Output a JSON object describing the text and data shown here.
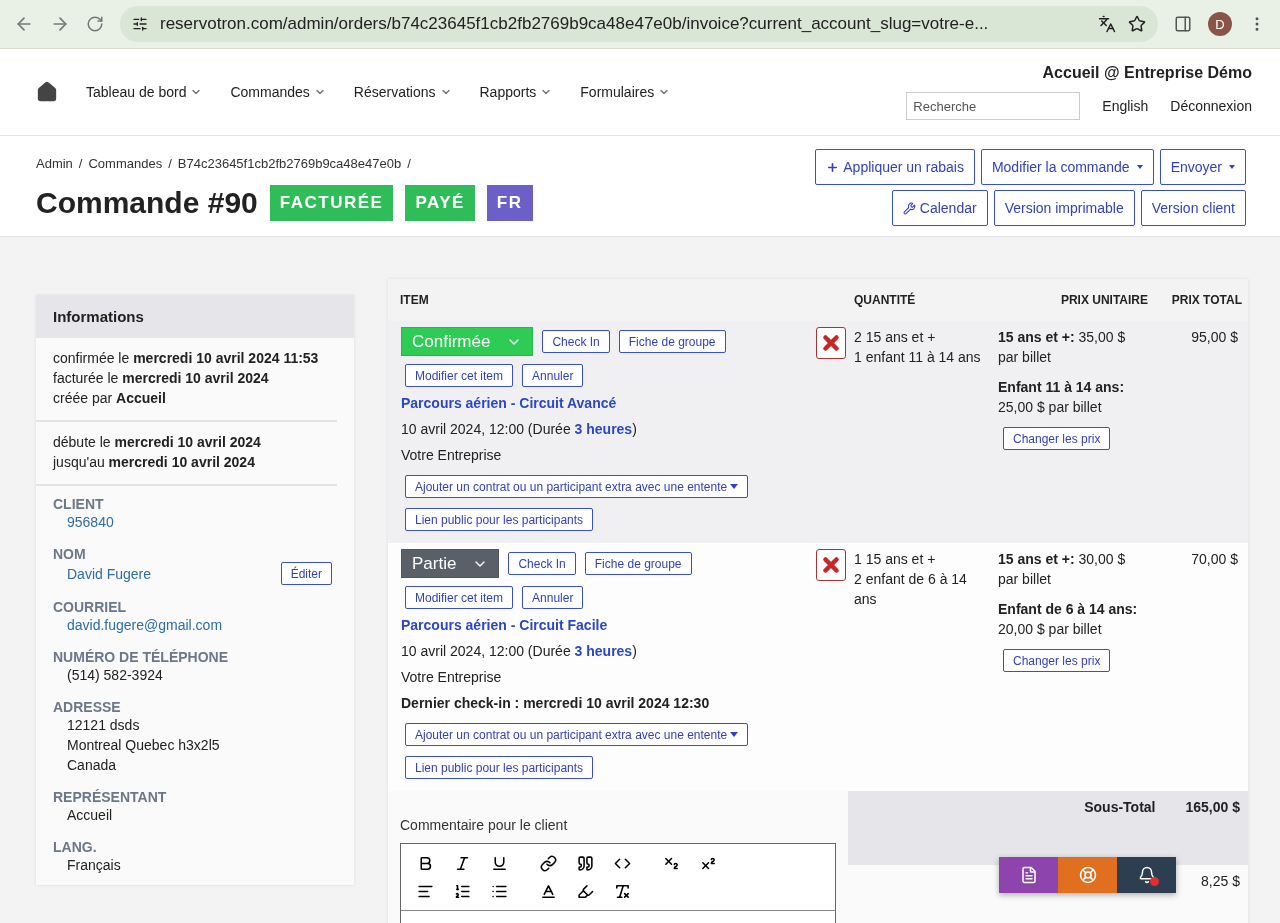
{
  "browser": {
    "url": "reservotron.com/admin/orders/b74c23645f1cb2fb2769b9ca48e47e0b/invoice?current_account_slug=votre-e...",
    "avatar": "D"
  },
  "nav": {
    "items": [
      {
        "label": "Tableau de bord"
      },
      {
        "label": "Commandes"
      },
      {
        "label": "Réservations"
      },
      {
        "label": "Rapports"
      },
      {
        "label": "Formulaires"
      }
    ],
    "account": "Accueil @ Entreprise Démo",
    "search_placeholder": "Recherche",
    "language": "English",
    "logout": "Déconnexion"
  },
  "header": {
    "breadcrumb": [
      {
        "label": "Admin",
        "separator": "/"
      },
      {
        "label": "Commandes",
        "separator": "/"
      },
      {
        "label": "B74c23645f1cb2fb2769b9ca48e47e0b",
        "separator": "/"
      }
    ],
    "title": "Commande #90",
    "badges": [
      {
        "label": "FACTURÉE",
        "color": "#2ebd59"
      },
      {
        "label": "PAYÉ",
        "color": "#2ebd59"
      },
      {
        "label": "FR",
        "color": "#6c5fc7"
      }
    ],
    "actions": [
      [
        {
          "label": "Appliquer un rabais",
          "kind": "plus"
        },
        {
          "label": "Modifier la commande",
          "kind": "caret"
        },
        {
          "label": "Envoyer",
          "kind": "caret"
        }
      ],
      [
        {
          "label": "Calendar",
          "kind": "wrench"
        },
        {
          "label": "Version imprimable",
          "kind": "plain"
        },
        {
          "label": "Version client",
          "kind": "plain"
        }
      ]
    ]
  },
  "info": {
    "title": "Informations",
    "groups": [
      [
        "confirmée le **mercredi 10 avril 2024 11:53**",
        "facturée le **mercredi 10 avril 2024**",
        "créée par **Accueil**"
      ],
      [
        "débute le **mercredi 10 avril 2024**",
        "jusqu'au **mercredi 10 avril 2024**"
      ]
    ],
    "fields": [
      {
        "label": "CLIENT",
        "kind": "link",
        "values": [
          "956840"
        ]
      },
      {
        "label": "NOM",
        "kind": "link",
        "values": [
          "David Fugere"
        ],
        "button": "Éditer"
      },
      {
        "label": "COURRIEL",
        "kind": "link",
        "values": [
          "david.fugere@gmail.com"
        ]
      },
      {
        "label": "NUMÉRO DE TÉLÉPHONE",
        "kind": "text",
        "values": [
          "(514) 582-3924"
        ]
      },
      {
        "label": "ADRESSE",
        "kind": "text",
        "values": [
          "12121 dsds",
          "Montreal Quebec h3x2l5",
          "Canada"
        ]
      },
      {
        "label": "REPRÉSENTANT",
        "kind": "text",
        "values": [
          "Accueil"
        ]
      },
      {
        "label": "LANG.",
        "kind": "text",
        "values": [
          "Français"
        ]
      }
    ]
  },
  "items": {
    "columns": [
      "ITEM",
      "QUANTITÉ",
      "PRIX UNITAIRE",
      "PRIX TOTAL"
    ],
    "rows": [
      {
        "status": {
          "label": "Confirmée",
          "color": "#2ecc55"
        },
        "check_in": "Check In",
        "group_sheet": "Fiche de groupe",
        "edit": "Modifier cet item",
        "cancel": "Annuler",
        "product": "Parcours aérien - Circuit Avancé",
        "schedule_prefix": "10 avril 2024, 12:00 (Durée",
        "duration": "3 heures",
        "schedule_suffix": ")",
        "location": "Votre Entreprise",
        "contract": "Ajouter un contrat ou un participant extra avec une entente",
        "public_link": "Lien public pour les participants",
        "quantity": [
          "2 15 ans et +",
          "1 enfant 11 à 14 ans"
        ],
        "prices": [
          "**15 ans et +:** 35,00 $ par billet",
          "**Enfant 11 à 14 ans:** 25,00 $ par billet"
        ],
        "change_price": "Changer les prix",
        "total": "95,00 $",
        "shaded": true
      },
      {
        "status": {
          "label": "Partie",
          "color": "#5a6068"
        },
        "check_in": "Check In",
        "group_sheet": "Fiche de groupe",
        "edit": "Modifier cet item",
        "cancel": "Annuler",
        "product": "Parcours aérien - Circuit Facile",
        "schedule_prefix": "10 avril 2024, 12:00 (Durée",
        "duration": "3 heures",
        "schedule_suffix": ")",
        "location": "Votre Entreprise",
        "last_checkin": "Dernier check-in : mercredi 10 avril 2024 12:30",
        "contract": "Ajouter un contrat ou un participant extra avec une entente",
        "public_link": "Lien public pour les participants",
        "quantity": [
          "1 15 ans et +",
          "2 enfant de 6 à 14 ans"
        ],
        "prices": [
          "**15 ans et +:** 30,00 $ par billet",
          "**Enfant de 6 à 14 ans:** 20,00 $ par billet"
        ],
        "change_price": "Changer les prix",
        "total": "70,00 $",
        "shaded": false
      }
    ]
  },
  "comment": {
    "label": "Commentaire pour le client"
  },
  "totals": [
    {
      "label": "Sous-Total",
      "value": "165,00 $",
      "shaded": true
    },
    {
      "value": "8,25 $",
      "shaded": false
    }
  ]
}
